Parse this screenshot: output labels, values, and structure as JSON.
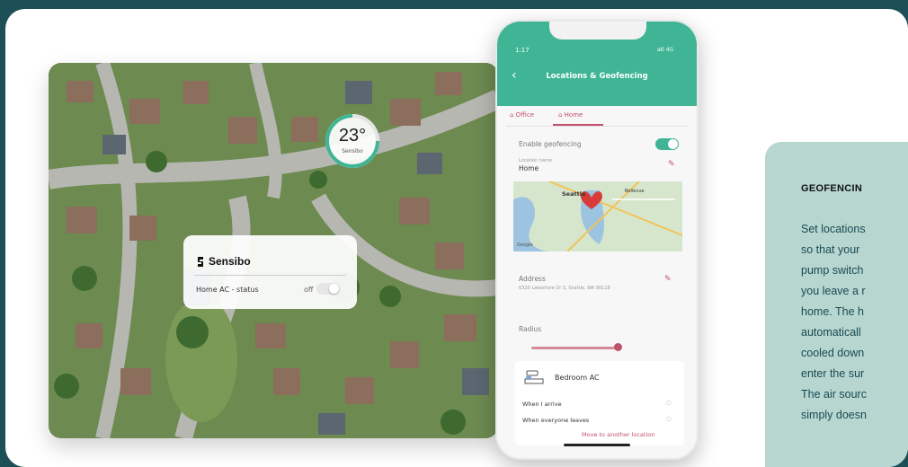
{
  "aerial": {
    "temperature": "23°",
    "temperature_sub": "Sensibo",
    "card": {
      "brand": "Sensibo",
      "status_label": "Home AC - status",
      "status_value": "off"
    }
  },
  "phone": {
    "time": "1:17",
    "signal": "atl 4G",
    "title": "Locations & Geofencing",
    "tabs": [
      "Office",
      "Home"
    ],
    "enable_label": "Enable geofencing",
    "location_name_label": "Location name",
    "location_name_value": "Home",
    "map_labels": [
      "Seattle",
      "Bellevue",
      "Google"
    ],
    "address_label": "Address",
    "address_value": "6320 Lakeshore Dr S, Seattle, WA 98118",
    "radius_label": "Radius",
    "radius_level": 0.92,
    "device": {
      "name": "Bedroom AC",
      "rows": [
        "When I arrive",
        "When everyone leaves"
      ],
      "move_link": "Move to another location"
    }
  },
  "info": {
    "title": "GEOFENCIN",
    "lines": [
      "Set locations",
      "so that your",
      "pump switch",
      "you leave a r",
      "home. The h",
      "automaticall",
      "cooled down",
      "enter the sur",
      "The air sourc",
      "simply doesn"
    ]
  }
}
